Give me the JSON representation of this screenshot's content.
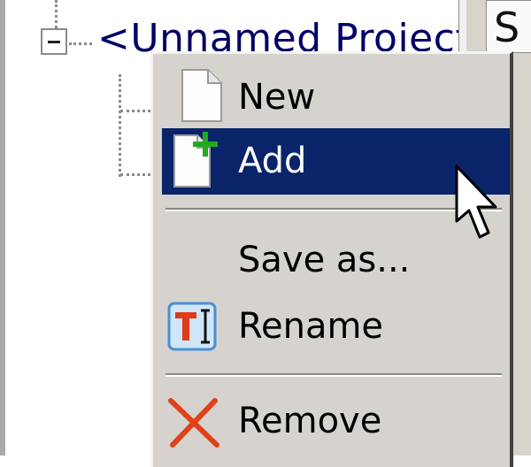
{
  "tree": {
    "project_label": "<Unnamed Project>"
  },
  "right_panel": {
    "tab_label": "S"
  },
  "context_menu": {
    "items": [
      {
        "label": "New",
        "icon": "new-document-icon",
        "highlighted": false
      },
      {
        "label": "Add",
        "icon": "add-document-icon",
        "highlighted": true
      },
      {
        "label": "Save as...",
        "icon": "",
        "highlighted": false
      },
      {
        "label": "Rename",
        "icon": "rename-icon",
        "highlighted": false
      },
      {
        "label": "Remove",
        "icon": "remove-x-icon",
        "highlighted": false
      }
    ],
    "highlight_color": "#0a246a",
    "menu_background": "#d6d3ce",
    "add_plus_color": "#22aa22",
    "remove_icon_color": "#e0401a",
    "rename_icon_color": "#e03a1a"
  }
}
